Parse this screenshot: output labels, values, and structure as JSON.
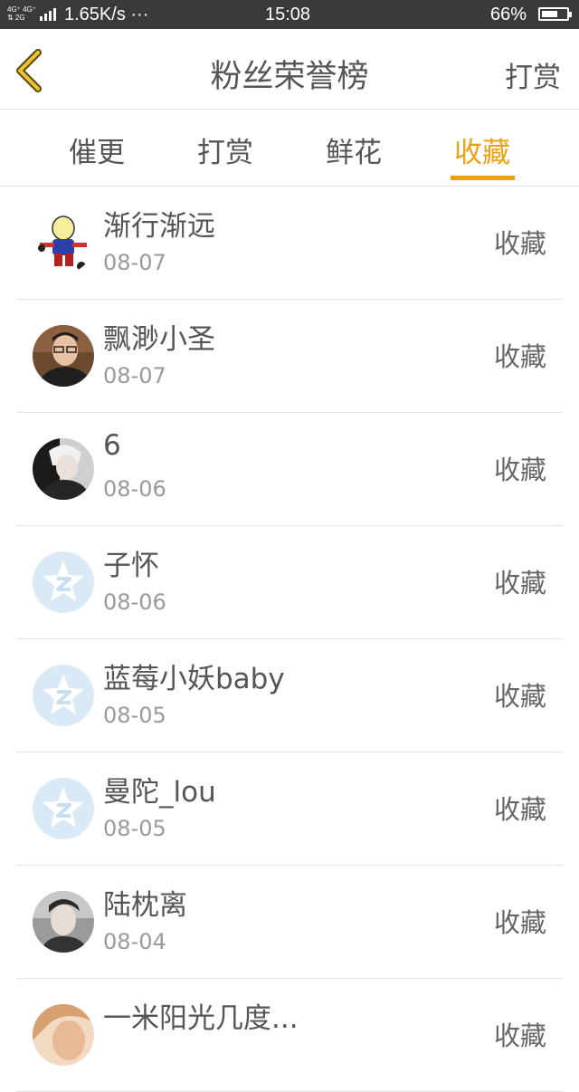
{
  "status_bar": {
    "network_labels": "4G⁺ 4G⁺\n⇅ 2G",
    "speed": "1.65K/s ···",
    "time": "15:08",
    "battery_percent": "66%",
    "battery_level": 0.66
  },
  "header": {
    "title": "粉丝荣誉榜",
    "action": "打赏",
    "back_icon": "chevron-left-icon"
  },
  "tabs": [
    {
      "label": "催更",
      "active": false
    },
    {
      "label": "打赏",
      "active": false
    },
    {
      "label": "鲜花",
      "active": false
    },
    {
      "label": "收藏",
      "active": true
    }
  ],
  "fans": [
    {
      "name": "渐行渐远",
      "date": "08-07",
      "action": "收藏",
      "avatar": "cartoon-figure-avatar"
    },
    {
      "name": "飘渺小圣",
      "date": "08-07",
      "action": "收藏",
      "avatar": "man-with-glasses-avatar"
    },
    {
      "name": "6",
      "date": "08-06",
      "action": "收藏",
      "avatar": "blond-person-avatar"
    },
    {
      "name": "子怀",
      "date": "08-06",
      "action": "收藏",
      "avatar": "default-star-avatar"
    },
    {
      "name": "蓝莓小妖baby",
      "date": "08-05",
      "action": "收藏",
      "avatar": "default-star-avatar"
    },
    {
      "name": "曼陀_lou",
      "date": "08-05",
      "action": "收藏",
      "avatar": "default-star-avatar"
    },
    {
      "name": "陆枕离",
      "date": "08-04",
      "action": "收藏",
      "avatar": "young-man-avatar"
    },
    {
      "name": "一米阳光几度...",
      "date": "",
      "action": "收藏",
      "avatar": "photo-avatar"
    }
  ],
  "colors": {
    "accent": "#f0a00c",
    "text": "#555555",
    "subtext": "#9a9a9a",
    "divider": "#e2e2e2",
    "status_bar_bg": "#3a3a3a"
  }
}
